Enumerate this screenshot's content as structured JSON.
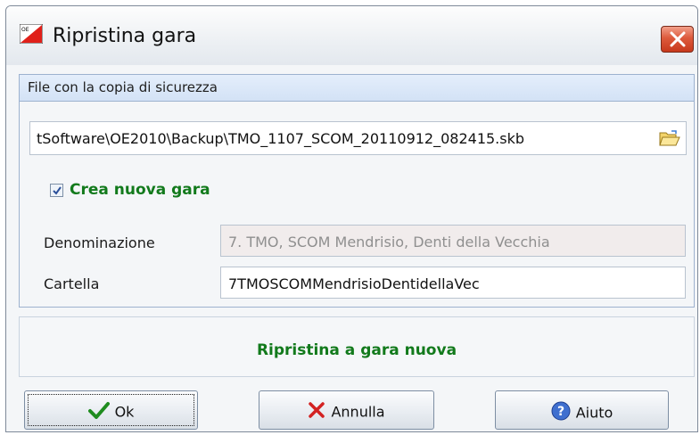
{
  "window": {
    "title": "Ripristina gara",
    "app_icon": "oe-flag-icon",
    "close_icon": "close-icon"
  },
  "backup_group": {
    "header": "File con la copia di sicurezza",
    "file_path": "tSoftware\\OE2010\\Backup\\TMO_1107_SCOM_20110912_082415.skb",
    "browse_icon": "folder-open-icon"
  },
  "create_new": {
    "checked": true,
    "label": "Crea nuova gara"
  },
  "fields": {
    "denominazione_label": "Denominazione",
    "denominazione_value": "7. TMO, SCOM Mendrisio, Denti della Vecchia",
    "cartella_label": "Cartella",
    "cartella_value": "7TMOSCOMMendrisioDentidellaVec"
  },
  "status": {
    "text": "Ripristina a gara nuova",
    "color": "#127a1c"
  },
  "buttons": {
    "ok": "Ok",
    "cancel": "Annulla",
    "help": "Aiuto"
  },
  "colors": {
    "accent_green": "#127a1c",
    "group_header": "#d3e2f6",
    "close_red": "#c7391c"
  }
}
